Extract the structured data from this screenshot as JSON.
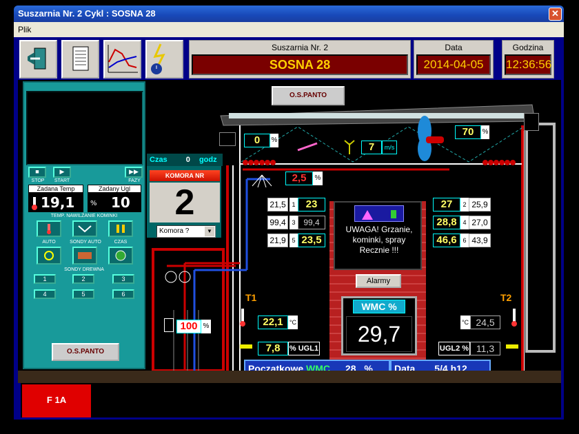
{
  "window": {
    "title": "Suszarnia Nr. 2 Cykl :  SOSNA 28",
    "close": "✕"
  },
  "menu": {
    "plik": "Plik"
  },
  "header": {
    "kiln_label": "Suszarnia Nr. 2",
    "kiln_value": "SOSNA 28",
    "date_label": "Data",
    "date_value": "2014-04-05",
    "time_label": "Godzina",
    "time_value": "12:36:56"
  },
  "left": {
    "stop": "STOP",
    "start": "START",
    "fazy": "FAZY",
    "zadana_temp_label": "Zadana Temp",
    "zadana_temp_value": "19,1",
    "zadany_ugl_label": "Zadany Ugl",
    "zadany_ugl_value": "10",
    "row1_label": "TEMP. NAWILŻANIE KOMINKI",
    "auto": "AUTO",
    "sondy_auto": "SONDY AUTO",
    "czas": "CZAS",
    "sondy_drewna": "SONDY DREWNA",
    "sondy": [
      "1",
      "2",
      "3",
      "4",
      "5",
      "6"
    ],
    "logo": "O.S.PANTO"
  },
  "komora": {
    "czas_label": "Czas",
    "czas_value": "0",
    "godz": "godz",
    "title": "KOMORA NR",
    "number": "2",
    "select": "Komora ?"
  },
  "logo_top": "O.S.PANTO",
  "vent": {
    "left_pct": "0",
    "pct_sign": "%",
    "wind": "7",
    "wind_unit": "m/s",
    "right_pct": "70"
  },
  "spray": {
    "value": "2,5",
    "unit": "%"
  },
  "left_sensors": [
    {
      "set": "21,5",
      "idx": "1",
      "val": "23"
    },
    {
      "set": "99,4",
      "idx": "3",
      "val": "99,4"
    },
    {
      "set": "21,9",
      "idx": "5",
      "val": "23,5"
    }
  ],
  "right_sensors": [
    {
      "val": "27",
      "idx": "2",
      "set": "25,9"
    },
    {
      "val": "28,8",
      "idx": "4",
      "set": "27,0"
    },
    {
      "val": "46,6",
      "idx": "6",
      "set": "43,9"
    }
  ],
  "warning": {
    "text": "UWAGA! Grzanie, kominki, spray Recznie !!!",
    "alarm_btn": "Alarmy"
  },
  "wmc": {
    "label": "WMC %",
    "value": "29,7"
  },
  "t1": {
    "label": "T1",
    "temp": "22,1",
    "unit": "°C",
    "ugl": "7,8",
    "ugl_unit": "% UGL1"
  },
  "t2": {
    "label": "T2",
    "temp": "24,5",
    "unit": "°C",
    "ugl": "11,3",
    "ugl_label": "UGL2 %"
  },
  "valve": {
    "value": "100",
    "unit": "%"
  },
  "initial": {
    "label": "Początkowe",
    "wmc": "WMC",
    "value": "28",
    "pct": "%"
  },
  "data_box": {
    "label": "Data",
    "value": "5/4 h12"
  },
  "status": {
    "f1a": "F 1A"
  },
  "colors": {
    "accent_red": "#c00000",
    "teal": "#189a9a",
    "yellow_text": "#ffff66"
  }
}
